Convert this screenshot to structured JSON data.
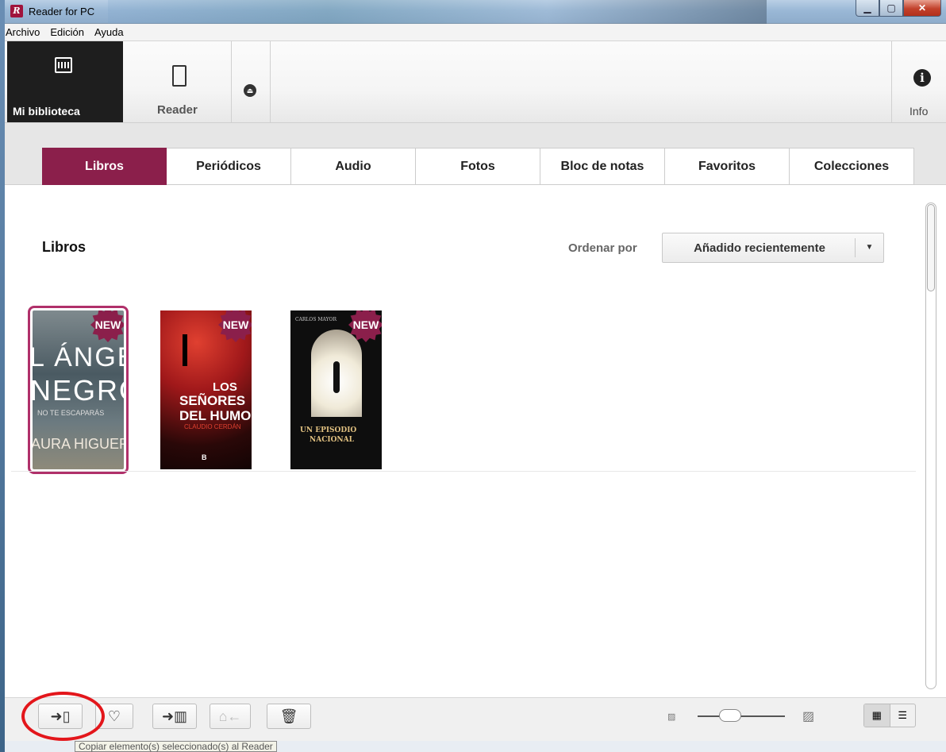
{
  "window": {
    "title": "Reader for PC",
    "app_icon_letter": "R"
  },
  "menu": [
    "Archivo",
    "Edición",
    "Ayuda"
  ],
  "topnav": {
    "library": "Mi biblioteca",
    "reader": "Reader",
    "info": "Info"
  },
  "tabs": [
    "Libros",
    "Periódicos",
    "Audio",
    "Fotos",
    "Bloc de notas",
    "Favoritos",
    "Colecciones"
  ],
  "active_tab": "Libros",
  "section": {
    "title": "Libros",
    "sort_label": "Ordenar por",
    "sort_value": "Añadido recientemente"
  },
  "books": [
    {
      "lines": [
        "L ÁNGE",
        "NEGRO",
        "NO TE ESCAPARÁS",
        "AURA HIGUER"
      ],
      "badge": "NEW",
      "selected": true
    },
    {
      "lines": [
        "LOS",
        "SEÑORES",
        "DEL HUMO",
        "CLAUDIO CERDÁN",
        "B"
      ],
      "badge": "NEW",
      "selected": false
    },
    {
      "lines": [
        "CARLOS MAYOR",
        "UN EPISODIO",
        "NACIONAL"
      ],
      "badge": "NEW",
      "selected": false
    }
  ],
  "bottom": {
    "tooltip": "Copiar elemento(s) seleccionado(s) al Reader",
    "icons": [
      "copy-to-reader-icon",
      "favorite-heart-icon",
      "add-to-collection-icon",
      "remove-from-collection-icon",
      "delete-trash-icon"
    ]
  },
  "colors": {
    "accent": "#8b1f4b",
    "highlight_circle": "#e3161b"
  }
}
